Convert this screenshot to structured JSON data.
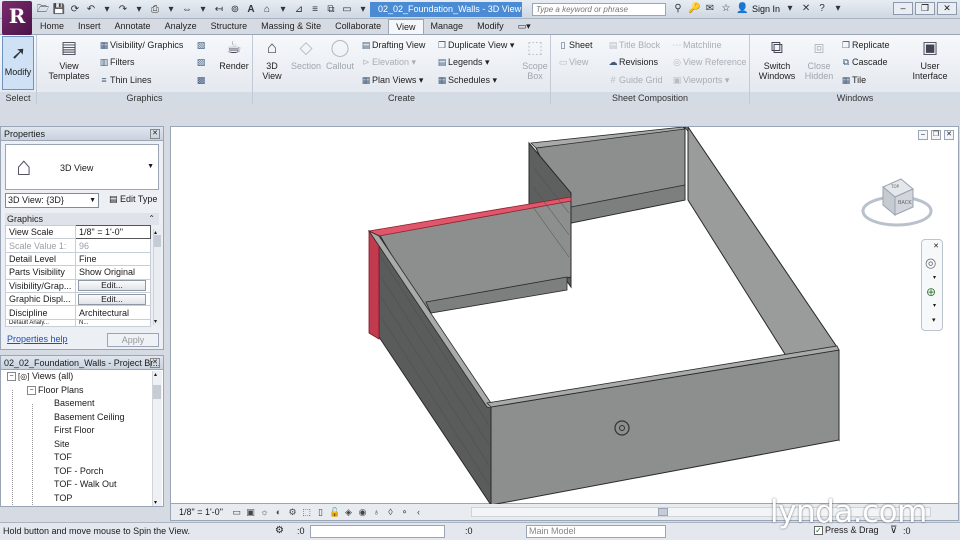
{
  "titlebar": {
    "app_logo": "R",
    "document_title": "02_02_Foundation_Walls - 3D View:...",
    "search_placeholder": "Type a keyword or phrase",
    "sign_in": "Sign In",
    "help": "?"
  },
  "tabs": [
    {
      "label": "Home"
    },
    {
      "label": "Insert"
    },
    {
      "label": "Annotate"
    },
    {
      "label": "Analyze"
    },
    {
      "label": "Structure"
    },
    {
      "label": "Massing & Site"
    },
    {
      "label": "Collaborate"
    },
    {
      "label": "View",
      "active": true
    },
    {
      "label": "Manage"
    },
    {
      "label": "Modify"
    }
  ],
  "ribbon": {
    "modify": "Modify",
    "select_title": "Select",
    "graphics": {
      "title": "Graphics",
      "view_templates": "View\nTemplates",
      "visibility_graphics": "Visibility/ Graphics",
      "filters": "Filters",
      "thin_lines": "Thin Lines"
    },
    "presentation": {
      "render": "Render"
    },
    "create": {
      "title": "Create",
      "view_3d": "3D\nView",
      "section": "Section",
      "callout": "Callout",
      "drafting_view": "Drafting View",
      "elevation": "Elevation",
      "plan_views": "Plan Views",
      "duplicate_view": "Duplicate View",
      "legends": "Legends",
      "schedules": "Schedules",
      "scope_box": "Scope\nBox"
    },
    "sheet_composition": {
      "title": "Sheet Composition",
      "sheet": "Sheet",
      "view": "View",
      "title_block": "Title Block",
      "revisions": "Revisions",
      "guide_grid": "Guide Grid",
      "matchline": "Matchline",
      "view_reference": "View Reference",
      "viewports": "Viewports"
    },
    "windows": {
      "title": "Windows",
      "switch_windows": "Switch\nWindows",
      "close_hidden": "Close\nHidden",
      "replicate": "Replicate",
      "cascade": "Cascade",
      "tile": "Tile",
      "user_interface": "User\nInterface"
    }
  },
  "properties": {
    "title": "Properties",
    "type_name": "3D View",
    "instance_selector": "3D View: {3D}",
    "edit_type": "Edit Type",
    "section": "Graphics",
    "rows": [
      {
        "key": "View Scale",
        "value": "1/8\" = 1'-0\""
      },
      {
        "key": "Scale Value   1:",
        "value": "96"
      },
      {
        "key": "Detail Level",
        "value": "Fine"
      },
      {
        "key": "Parts Visibility",
        "value": "Show Original"
      },
      {
        "key": "Visibility/Grap...",
        "value": "Edit..."
      },
      {
        "key": "Graphic Displ...",
        "value": "Edit..."
      },
      {
        "key": "Discipline",
        "value": "Architectural"
      },
      {
        "key": "Default Analy...",
        "value": "N..."
      }
    ],
    "help_link": "Properties help",
    "apply": "Apply"
  },
  "browser": {
    "title": "02_02_Foundation_Walls - Project Br...",
    "root": "Views (all)",
    "group": "Floor Plans",
    "items": [
      "Basement",
      "Basement Ceiling",
      "First Floor",
      "Site",
      "TOF",
      "TOF - Porch",
      "TOF - Walk Out",
      "TOP"
    ]
  },
  "viewcube": {
    "face_top": "TOP",
    "face_back": "BACK"
  },
  "viewbar": {
    "scale": "1/8\" = 1'-0\""
  },
  "statusbar": {
    "message": "Hold button and move mouse to Spin the View.",
    "selection_count": ":0",
    "workset_count": ":0",
    "model": "Main Model",
    "press_drag": "Press & Drag",
    "filter_count": ":0"
  },
  "watermark": "lynda.com",
  "colors": {
    "wall_face": "#8d8e8e",
    "wall_top": "#a9aaaa",
    "selected_wall": "#e0566a",
    "accent": "#4b8bd4"
  }
}
